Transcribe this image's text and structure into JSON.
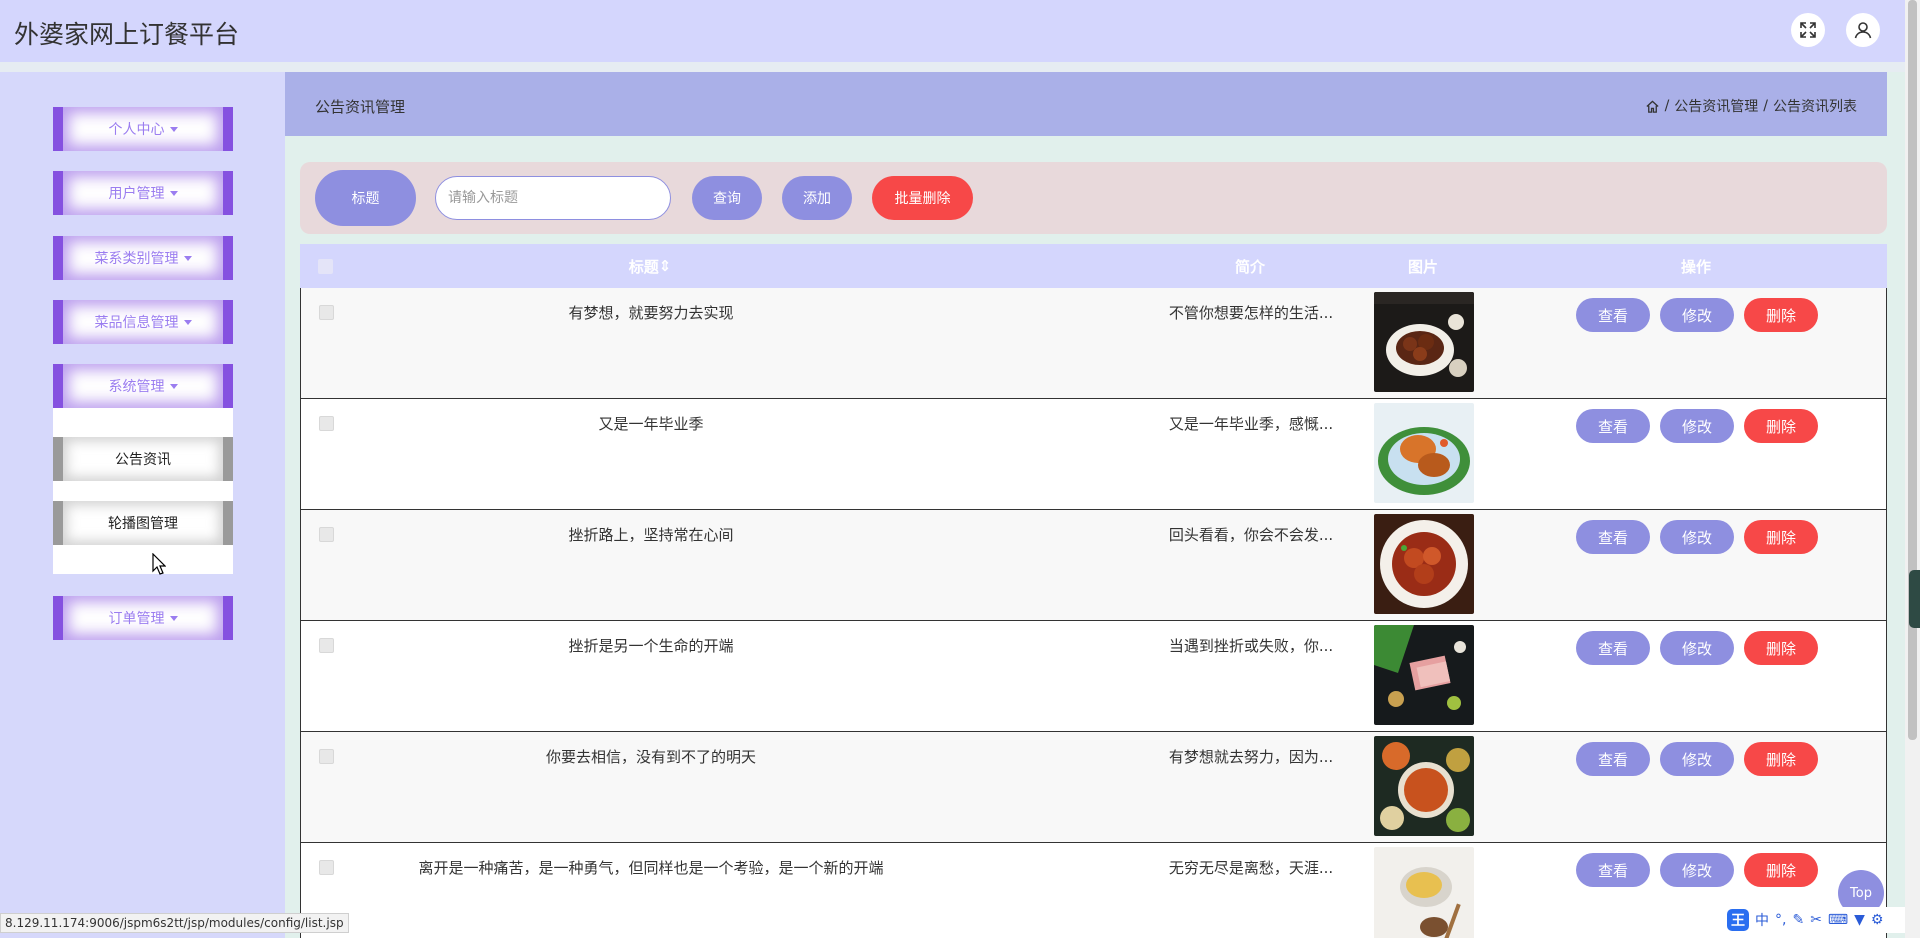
{
  "header": {
    "brand": "外婆家网上订餐平台",
    "fullscreen_icon": "fullscreen-icon",
    "user_icon": "user-icon"
  },
  "sidebar": {
    "menus": [
      {
        "label": "个人中心"
      },
      {
        "label": "用户管理"
      },
      {
        "label": "菜系类别管理"
      },
      {
        "label": "菜品信息管理"
      },
      {
        "label": "系统管理"
      }
    ],
    "submenu": [
      {
        "label": "公告资讯"
      },
      {
        "label": "轮播图管理"
      }
    ],
    "last_menu": {
      "label": "订单管理"
    }
  },
  "page": {
    "title": "公告资讯管理",
    "breadcrumb": [
      "公告资讯管理",
      "公告资讯列表"
    ],
    "breadcrumb_sep": "/"
  },
  "search": {
    "field_label": "标题",
    "placeholder": "请输入标题",
    "value": "",
    "query_label": "查询",
    "add_label": "添加",
    "bulk_delete_label": "批量删除"
  },
  "table": {
    "headers": {
      "title": "标题",
      "intro": "简介",
      "image": "图片",
      "actions": "操作"
    },
    "rows": [
      {
        "title": "有梦想，就要努力去实现",
        "intro": "不管你想要怎样的生活..."
      },
      {
        "title": "又是一年毕业季",
        "intro": "又是一年毕业季，感慨..."
      },
      {
        "title": "挫折路上，坚持常在心间",
        "intro": "回头看看，你会不会发..."
      },
      {
        "title": "挫折是另一个生命的开端",
        "intro": "当遇到挫折或失败，你..."
      },
      {
        "title": "你要去相信，没有到不了的明天",
        "intro": "有梦想就去努力，因为..."
      },
      {
        "title": "离开是一种痛苦，是一种勇气，但同样也是一个考验，是一个新的开端",
        "intro": "无穷无尽是离愁，天涯..."
      }
    ],
    "action_labels": {
      "view": "查看",
      "edit": "修改",
      "delete": "删除"
    }
  },
  "status_url": "8.129.11.174:9006/jspm6s2tt/jsp/modules/config/list.jsp",
  "top_button": "Top",
  "ime": {
    "logo": "王",
    "mode": "中"
  },
  "colors": {
    "header_bg": "#d4d6fd",
    "accent": "#8e8fe0",
    "danger": "#f74848",
    "menu_border": "#8551e0",
    "title_bar": "#aab0e8"
  }
}
